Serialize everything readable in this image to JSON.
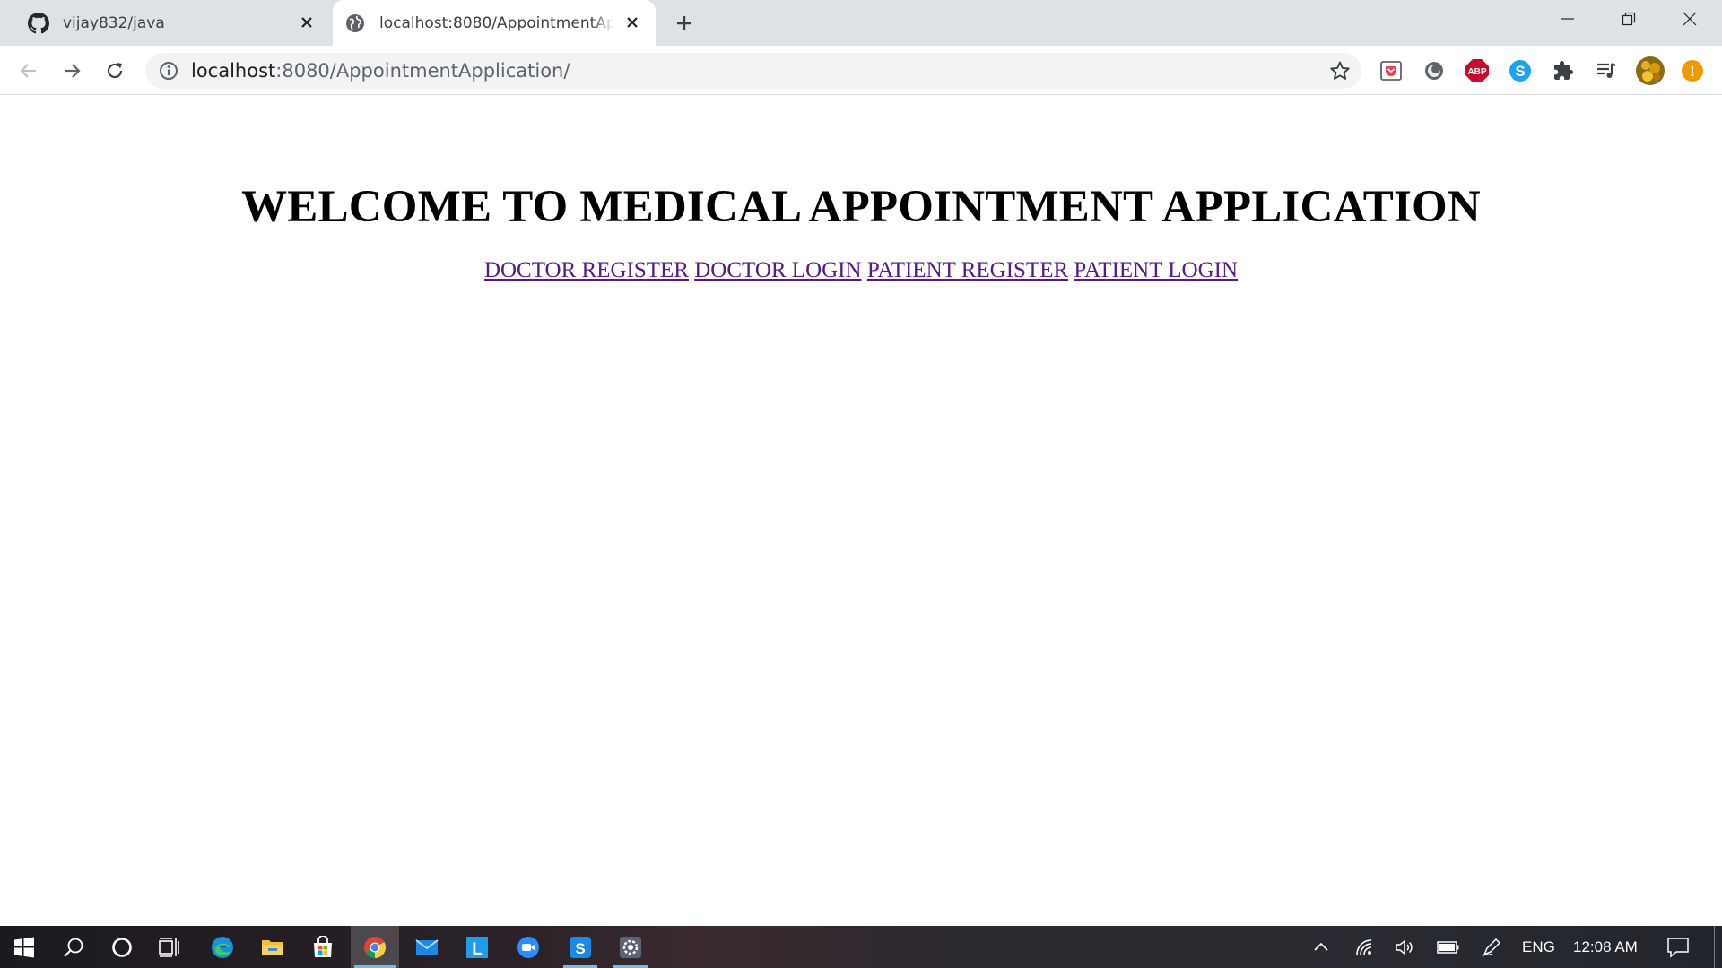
{
  "browser": {
    "tabs": [
      {
        "title": "vijay832/java",
        "icon": "github-icon",
        "active": false
      },
      {
        "title": "localhost:8080/AppointmentApplication/",
        "icon": "globe-icon",
        "active": true
      }
    ],
    "address_bar": {
      "host": "localhost",
      "rest": ":8080/AppointmentApplication/"
    },
    "extensions": [
      "pocket-icon",
      "ghostery-icon",
      "adblock-plus-icon",
      "skype-icon",
      "puzzle-extensions-icon",
      "media-queue-icon",
      "profile-avatar",
      "update-alert-icon"
    ],
    "extension_labels": {
      "adblock": "ABP",
      "skype": "S",
      "alert": "!"
    }
  },
  "page": {
    "heading": "WELCOME TO MEDICAL APPOINTMENT APPLICATION",
    "links": [
      "DOCTOR REGISTER",
      "DOCTOR LOGIN",
      "PATIENT REGISTER",
      "PATIENT LOGIN"
    ],
    "link_color": "#551a8b"
  },
  "taskbar": {
    "apps": [
      "start-icon",
      "search-icon",
      "cortana-icon",
      "task-view-icon",
      "edge-icon",
      "file-explorer-icon",
      "store-icon",
      "chrome-icon",
      "mail-icon",
      "l-app-icon",
      "zoom-icon",
      "skype-icon",
      "settings-app-icon"
    ],
    "app_letters": {
      "l_app": "L",
      "skype": "S"
    },
    "tray": {
      "language": "ENG",
      "time": "12:08 AM"
    }
  }
}
